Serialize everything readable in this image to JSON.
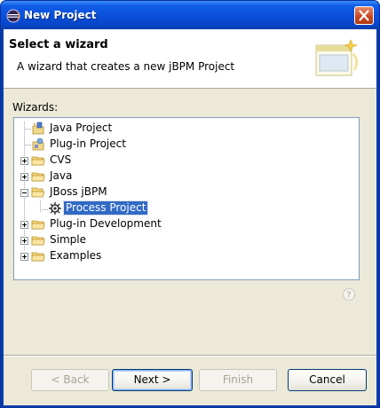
{
  "window": {
    "title": "New Project"
  },
  "header": {
    "title": "Select a wizard",
    "description": "A wizard that creates a new jBPM Project"
  },
  "wizards": {
    "label": "Wizards:",
    "items": [
      {
        "label": "Java Project",
        "icon": "java-project-icon"
      },
      {
        "label": "Plug-in Project",
        "icon": "plugin-project-icon"
      },
      {
        "label": "CVS",
        "icon": "folder-icon",
        "expanded": false
      },
      {
        "label": "Java",
        "icon": "folder-icon",
        "expanded": false
      },
      {
        "label": "JBoss jBPM",
        "icon": "folder-open-icon",
        "expanded": true
      },
      {
        "label": "Process Project",
        "icon": "process-project-icon",
        "selected": true
      },
      {
        "label": "Plug-in Development",
        "icon": "folder-icon",
        "expanded": false
      },
      {
        "label": "Simple",
        "icon": "folder-icon",
        "expanded": false
      },
      {
        "label": "Examples",
        "icon": "folder-icon",
        "expanded": false
      }
    ]
  },
  "buttons": {
    "back": "< Back",
    "next": "Next >",
    "finish": "Finish",
    "cancel": "Cancel"
  },
  "colors": {
    "selection": "#316ac5",
    "titlebar": "#0a4fd9",
    "dialog": "#ece9d8"
  }
}
